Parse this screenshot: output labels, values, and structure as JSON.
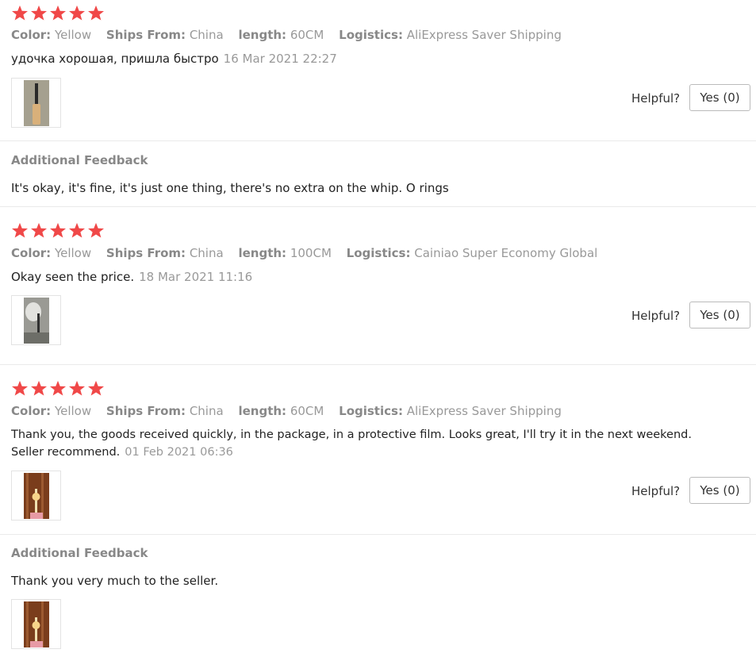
{
  "colors": {
    "star": "#f04848",
    "label": "#888888",
    "value": "#999999",
    "text": "#222222"
  },
  "icons": {
    "star": "star-icon"
  },
  "reviews": [
    {
      "stars": 5,
      "attrs": [
        {
          "k": "Color:",
          "v": "Yellow"
        },
        {
          "k": "Ships From:",
          "v": "China"
        },
        {
          "k": "length:",
          "v": "60CM"
        },
        {
          "k": "Logistics:",
          "v": "AliExpress Saver Shipping"
        }
      ],
      "text": "удочка хорошая, пришла быстро",
      "date": "16 Mar 2021 22:27",
      "helpful_label": "Helpful?",
      "yes_label": "Yes (0)",
      "additional": {
        "title": "Additional Feedback",
        "text": "It's okay, it's fine, it's just one thing, there's no extra on the whip. O rings"
      }
    },
    {
      "stars": 5,
      "attrs": [
        {
          "k": "Color:",
          "v": "Yellow"
        },
        {
          "k": "Ships From:",
          "v": "China"
        },
        {
          "k": "length:",
          "v": "100CM"
        },
        {
          "k": "Logistics:",
          "v": "Cainiao Super Economy Global"
        }
      ],
      "text": "Okay seen the price.",
      "date": "18 Mar 2021 11:16",
      "helpful_label": "Helpful?",
      "yes_label": "Yes (0)"
    },
    {
      "stars": 5,
      "attrs": [
        {
          "k": "Color:",
          "v": "Yellow"
        },
        {
          "k": "Ships From:",
          "v": "China"
        },
        {
          "k": "length:",
          "v": "60CM"
        },
        {
          "k": "Logistics:",
          "v": "AliExpress Saver Shipping"
        }
      ],
      "text_line1": "Thank you, the goods received quickly, in the package, in a protective film. Looks great, I'll try it in the next weekend.",
      "text_line2": "Seller recommend.",
      "date": "01 Feb 2021 06:36",
      "helpful_label": "Helpful?",
      "yes_label": "Yes (0)",
      "additional": {
        "title": "Additional Feedback",
        "text": "Thank you very much to the seller."
      }
    }
  ]
}
